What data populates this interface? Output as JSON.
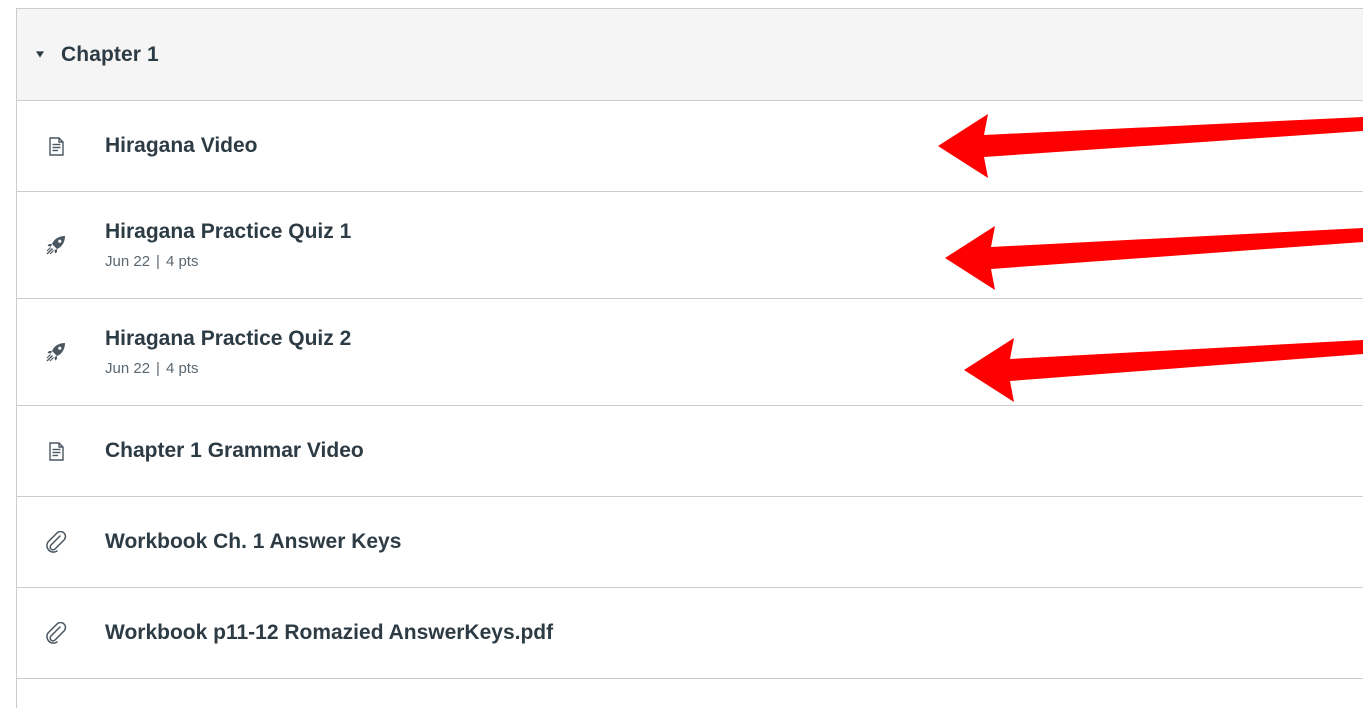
{
  "module": {
    "title": "Chapter 1",
    "toggle_icon": "caret-down-icon",
    "items": [
      {
        "title": "Hiragana Video",
        "icon": "page-document-icon",
        "type": "page"
      },
      {
        "title": "Hiragana Practice Quiz 1",
        "icon": "quiz-rocket-icon",
        "type": "quiz",
        "due": "Jun 22",
        "separator": "|",
        "points": "4 pts"
      },
      {
        "title": "Hiragana Practice Quiz 2",
        "icon": "quiz-rocket-icon",
        "type": "quiz",
        "due": "Jun 22",
        "separator": "|",
        "points": "4 pts"
      },
      {
        "title": "Chapter 1 Grammar Video",
        "icon": "page-document-icon",
        "type": "page"
      },
      {
        "title": "Workbook Ch. 1 Answer Keys",
        "icon": "paperclip-icon",
        "type": "attachment"
      },
      {
        "title": "Workbook p11-12 Romazied AnswerKeys.pdf",
        "icon": "paperclip-icon",
        "type": "attachment"
      }
    ]
  },
  "annotations": {
    "arrow_color": "#ff0000",
    "arrow_targets": [
      "Hiragana Video",
      "Hiragana Practice Quiz 1",
      "Hiragana Practice Quiz 2"
    ]
  },
  "colors": {
    "header_bg": "#f5f5f5",
    "border": "#c7cdd1",
    "text": "#2d3b45",
    "meta_text": "#5b6770"
  }
}
